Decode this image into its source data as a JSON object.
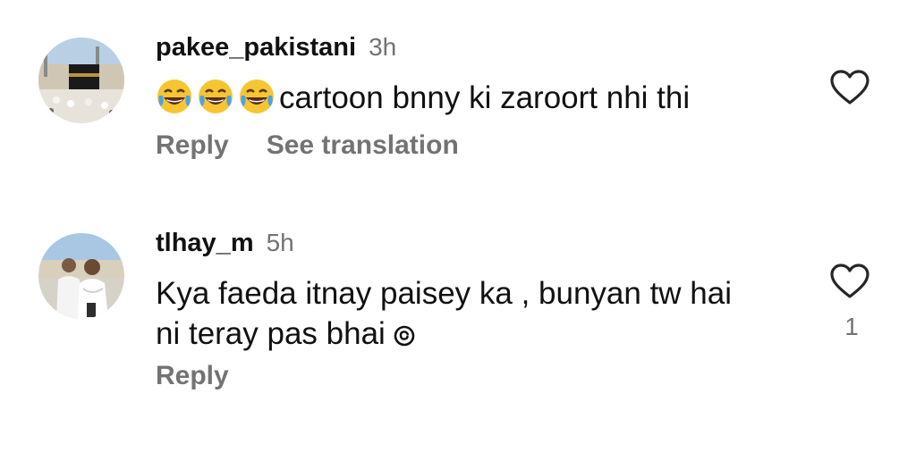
{
  "comments": [
    {
      "username": "pakee_pakistani",
      "time": "3h",
      "emojis": [
        "face-with-tears-of-joy",
        "face-with-tears-of-joy",
        "face-with-tears-of-joy"
      ],
      "text": "cartoon bnny ki zaroort nhi thi",
      "actions": {
        "reply": "Reply",
        "translate": "See translation"
      },
      "like_icon": "heart-outline-icon",
      "avatar": "kaaba-photo-avatar"
    },
    {
      "username": "tlhay_m",
      "time": "5h",
      "text_line1": "Kya faeda itnay paisey ka , bunyan tw hai",
      "text_line2": "ni teray pas bhai",
      "inline_icon": "threads-icon",
      "actions": {
        "reply": "Reply"
      },
      "like_icon": "heart-outline-icon",
      "like_count": "1",
      "avatar": "two-men-ihram-photo-avatar"
    }
  ],
  "colors": {
    "primary_text": "#111111",
    "secondary_text": "#737373",
    "background": "#ffffff"
  }
}
